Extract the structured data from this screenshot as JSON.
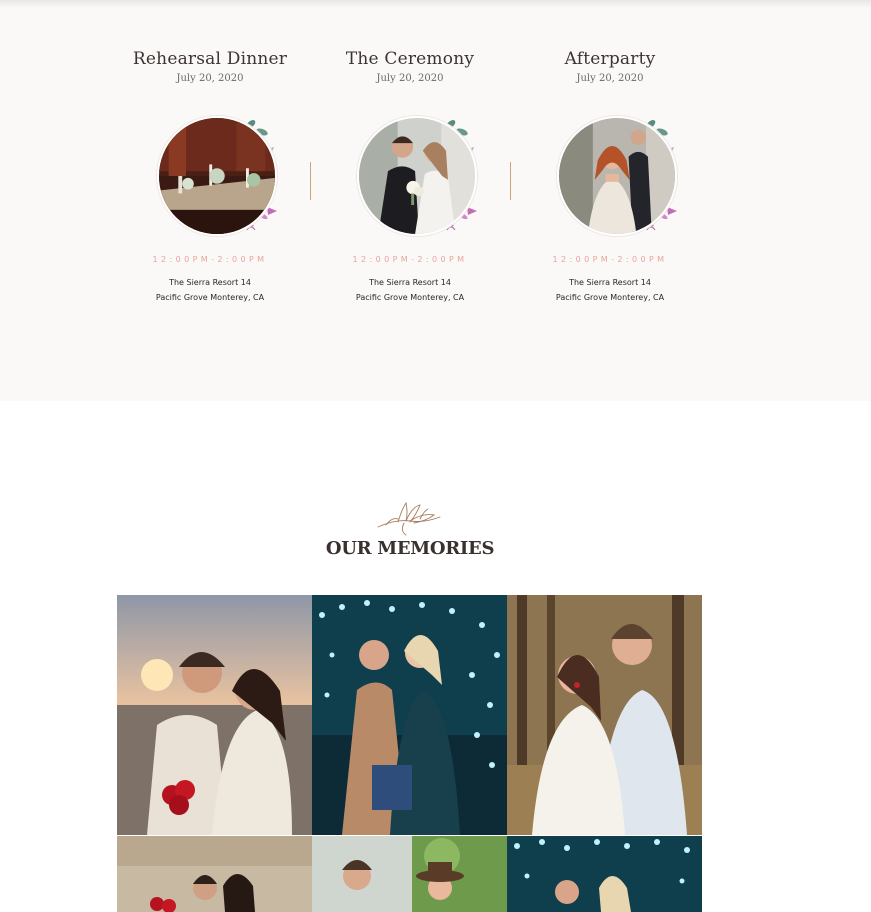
{
  "events": [
    {
      "title": "Rehearsal Dinner",
      "date": "July 20, 2020",
      "time": "12:00PM-2:00PM",
      "address_line1": "The Sierra Resort 14",
      "address_line2": "Pacific Grove Monterey, CA",
      "photo": "dinner-table-photo"
    },
    {
      "title": "The Ceremony",
      "date": "July 20, 2020",
      "time": "12:00PM-2:00PM",
      "address_line1": "The Sierra Resort 14",
      "address_line2": "Pacific Grove Monterey, CA",
      "photo": "bride-and-groom-photo"
    },
    {
      "title": "Afterparty",
      "date": "July 20, 2020",
      "time": "12:00PM-2:00PM",
      "address_line1": "The Sierra Resort 14",
      "address_line2": "Pacific Grove Monterey, CA",
      "photo": "bride-portrait-photo"
    }
  ],
  "memories": {
    "title": "OUR MEMORIES",
    "ornament_icon": "lily-flower-icon",
    "photos": [
      "beach-sunset-couple",
      "string-lights-couple",
      "forest-couple",
      "wall-couple-roses",
      "couple-with-hat",
      "string-lights-couple-2"
    ]
  },
  "colors": {
    "section_bg": "#fbf9f7",
    "time_text": "#e6a59c",
    "divider": "#c8a578",
    "leaf_green": "#5d8a7f",
    "leaf_purple": "#b34fa8"
  }
}
